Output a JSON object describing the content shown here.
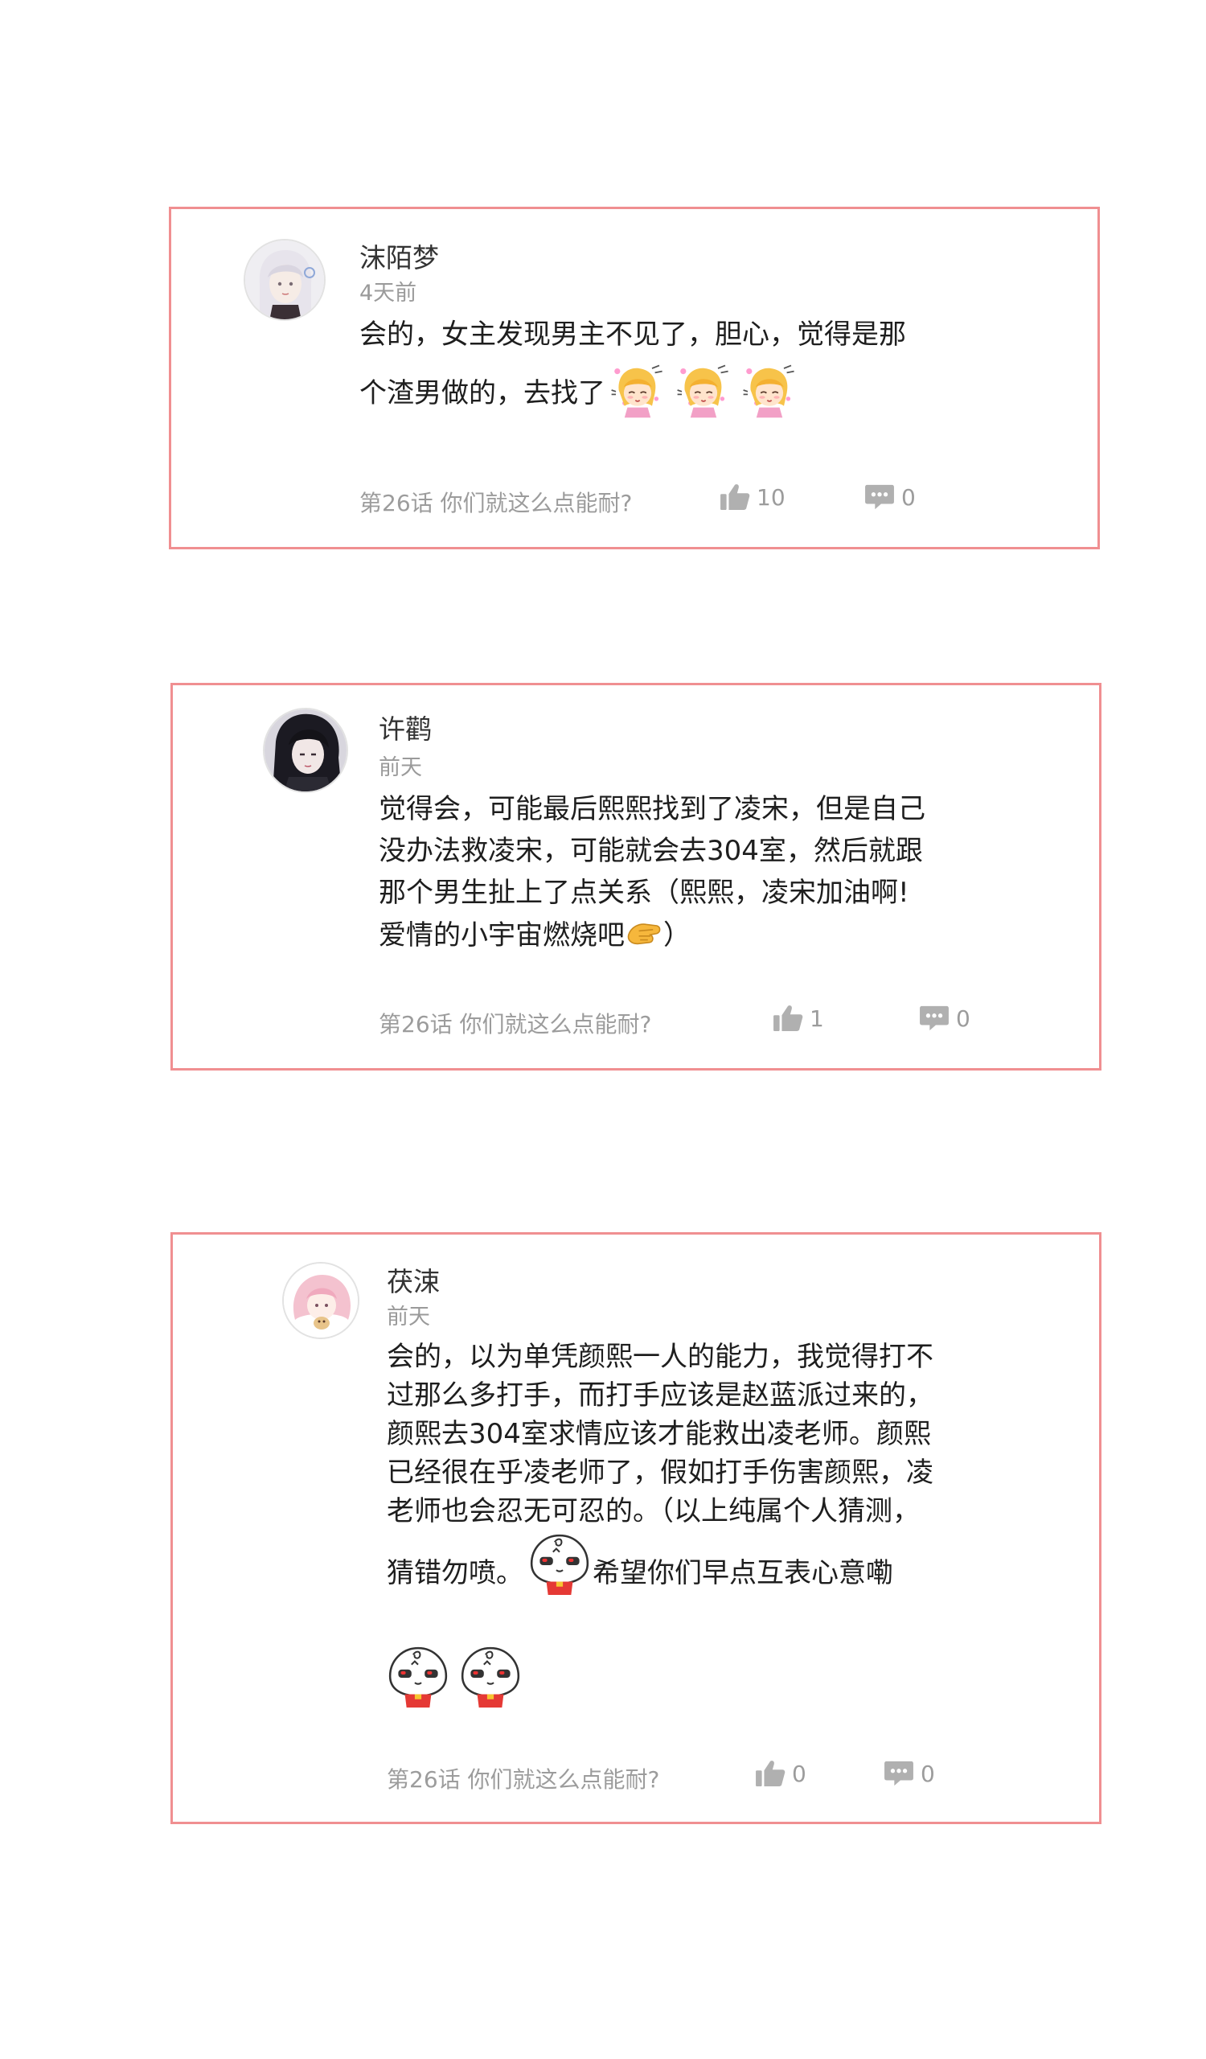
{
  "comments": [
    {
      "username": "沫陌梦",
      "time": "4天前",
      "content_lines": [
        "会的，女主发现男主不见了，胆心，觉得是那",
        "个渣男做的，去找了"
      ],
      "chapter": "第26话 你们就这么点能耐?",
      "likes": "10",
      "replies": "0"
    },
    {
      "username": "许鹳",
      "time": "前天",
      "content_lines": [
        "觉得会，可能最后熙熙找到了凌宋，但是自己",
        "没办法救凌宋，可能就会去304室，然后就跟",
        "那个男生扯上了点关系（熙熙，凌宋加油啊!",
        "爱情的小宇宙燃烧吧",
        "）"
      ],
      "chapter": "第26话 你们就这么点能耐?",
      "likes": "1",
      "replies": "0"
    },
    {
      "username": "茯涑",
      "time": "前天",
      "content_lines": [
        "会的，以为单凭颜熙一人的能力，我觉得打不",
        "过那么多打手，而打手应该是赵蓝派过来的，",
        "颜熙去304室求情应该才能救出凌老师。颜熙",
        "已经很在乎凌老师了，假如打手伤害颜熙，凌",
        "老师也会忍无可忍的。（以上纯属个人猜测，",
        "猜错勿喷。",
        "希望你们早点互表心意嘞"
      ],
      "chapter": "第26话 你们就这么点能耐?",
      "likes": "0",
      "replies": "0"
    }
  ],
  "icons": {
    "like": "thumbs-up-icon",
    "reply": "comment-icon",
    "sticker_girl": "blonde-girl-sticker",
    "sticker_baozi": "baozi-sticker",
    "sticker_hands": "clasped-hands-emoji"
  },
  "colors": {
    "card_border": "#f08f91",
    "meta_text": "#9c9c9c",
    "icon": "#aeaeae"
  }
}
